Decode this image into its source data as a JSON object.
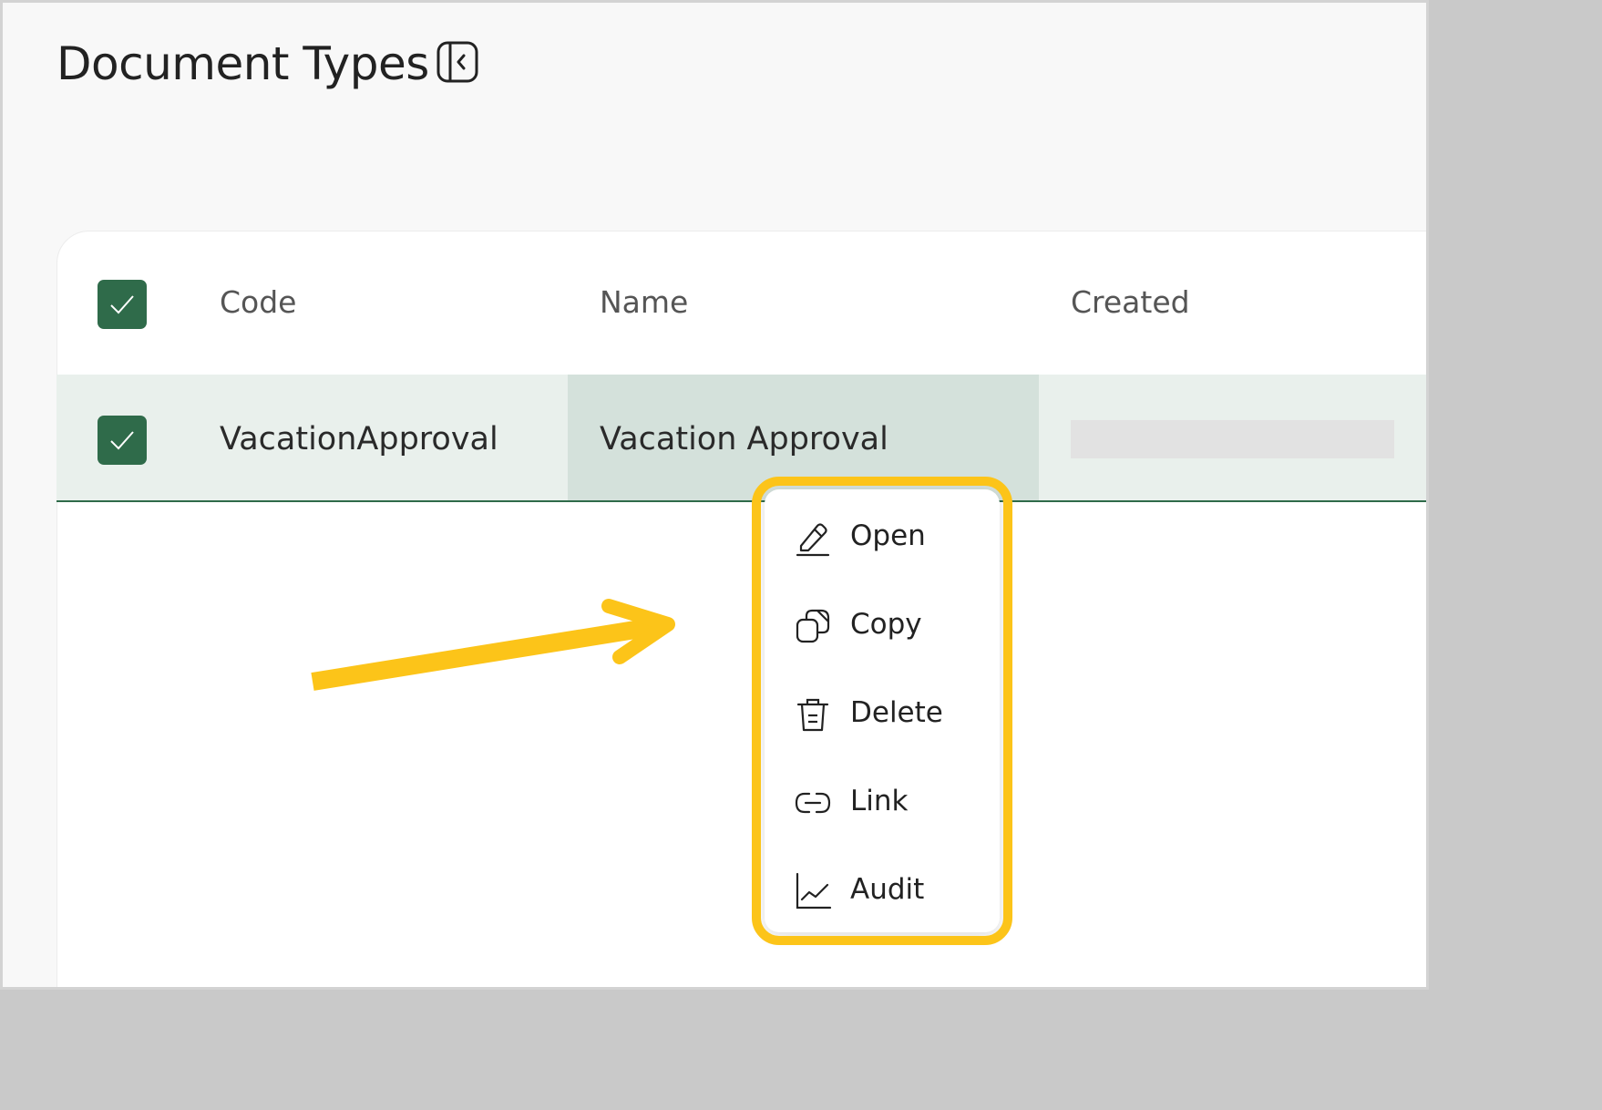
{
  "page": {
    "title": "Document Types"
  },
  "table": {
    "columns": [
      "Code",
      "Name",
      "Created"
    ],
    "rows": [
      {
        "code": "VacationApproval",
        "name": "Vacation Approval",
        "created": ""
      }
    ]
  },
  "context_menu": {
    "items": [
      {
        "label": "Open",
        "icon": "pencil-icon"
      },
      {
        "label": "Copy",
        "icon": "copy-icon"
      },
      {
        "label": "Delete",
        "icon": "trash-icon"
      },
      {
        "label": "Link",
        "icon": "link-icon"
      },
      {
        "label": "Audit",
        "icon": "chart-line-icon"
      }
    ]
  },
  "colors": {
    "accent_green": "#2f6b4a",
    "highlight_yellow": "#fcc419",
    "row_selected": "#e9f0ec",
    "cell_focused": "#d4e1db"
  }
}
